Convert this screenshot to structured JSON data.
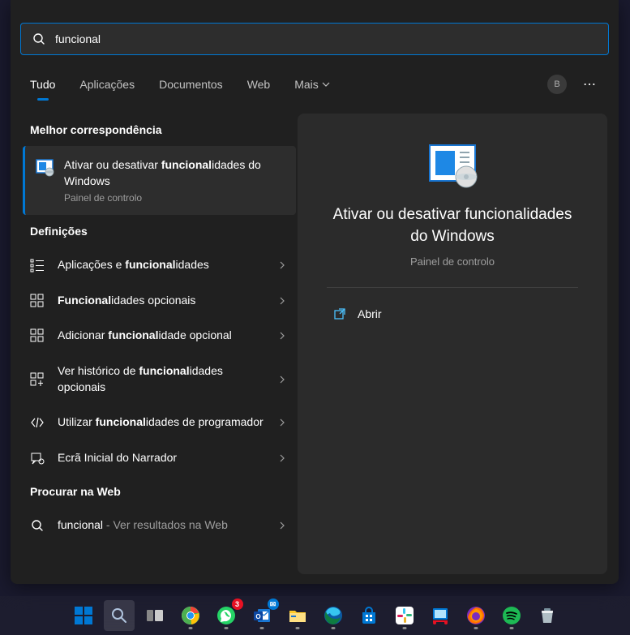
{
  "search": {
    "query": "funcional"
  },
  "tabs": {
    "all": "Tudo",
    "apps": "Aplicações",
    "docs": "Documentos",
    "web": "Web",
    "more": "Mais"
  },
  "avatar_initial": "B",
  "sections": {
    "best": "Melhor correspondência",
    "settings": "Definições",
    "web": "Procurar na Web"
  },
  "best_match": {
    "title_pre": "Ativar ou desativar ",
    "title_bold": "funcional",
    "title_post": "idades do Windows",
    "subtitle": "Painel de controlo"
  },
  "settings_items": [
    {
      "pre": "Aplicações e ",
      "bold": "funcional",
      "post": "idades",
      "icon": "list"
    },
    {
      "pre": "",
      "bold": "Funcional",
      "post": "idades opcionais",
      "icon": "grid"
    },
    {
      "pre": "Adicionar ",
      "bold": "funcional",
      "post": "idade opcional",
      "icon": "grid"
    },
    {
      "pre": "Ver histórico de ",
      "bold": "funcional",
      "post": "idades opcionais",
      "icon": "gridplus"
    },
    {
      "pre": "Utilizar ",
      "bold": "funcional",
      "post": "idades de programador",
      "icon": "dev"
    },
    {
      "pre": "Ecrã Inicial do Narrador",
      "bold": "",
      "post": "",
      "icon": "narrator"
    }
  ],
  "web_item": {
    "term": "funcional",
    "suffix": " - Ver resultados na Web"
  },
  "preview": {
    "title": "Ativar ou desativar funcionalidades do Windows",
    "subtitle": "Painel de controlo",
    "open": "Abrir"
  },
  "taskbar_badges": {
    "whatsapp": "3"
  }
}
